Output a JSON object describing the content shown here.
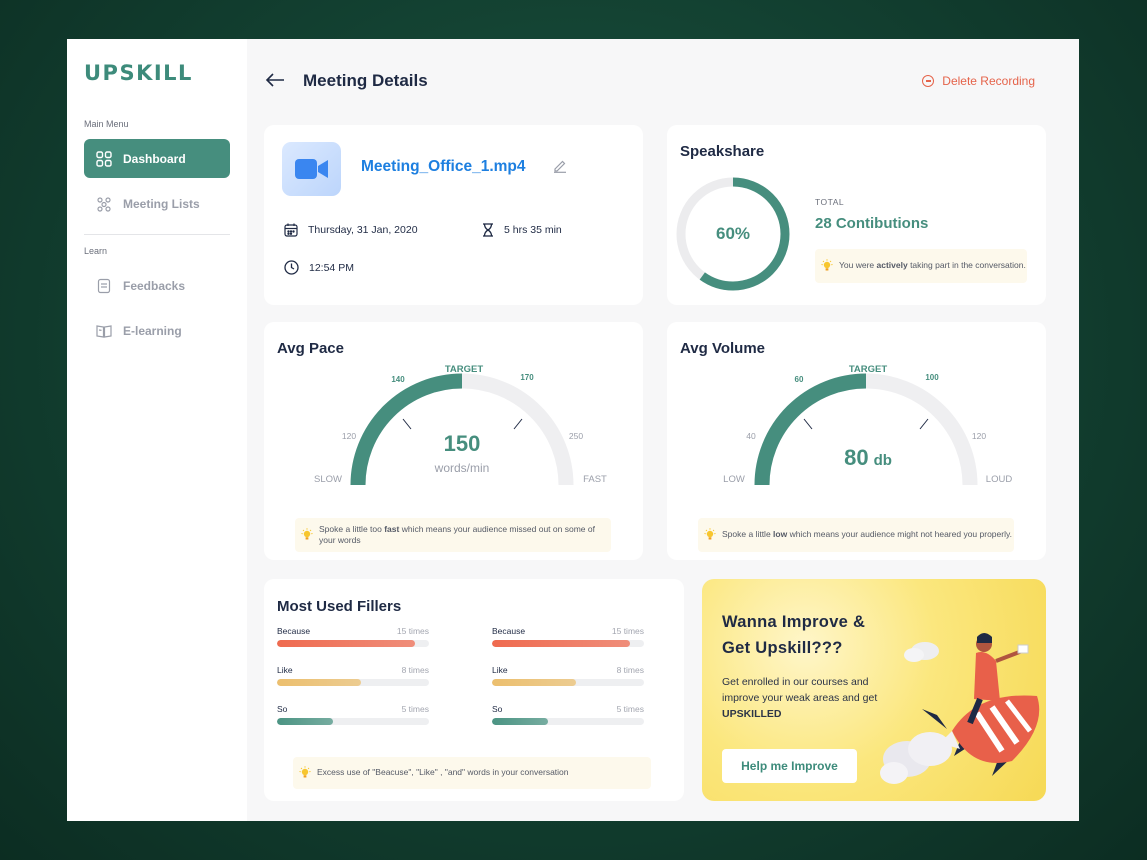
{
  "sidebar": {
    "logo": "UPSKILL",
    "main_menu_heading": "Main Menu",
    "items": [
      {
        "label": "Dashboard",
        "icon": "grid-icon",
        "active": true
      },
      {
        "label": "Meeting Lists",
        "icon": "people-icon",
        "active": false
      }
    ],
    "learn_heading": "Learn",
    "learn_items": [
      {
        "label": "Feedbacks",
        "icon": "document-icon"
      },
      {
        "label": "E-learning",
        "icon": "book-icon"
      }
    ]
  },
  "header": {
    "title": "Meeting Details",
    "delete_label": "Delete Recording"
  },
  "meeting": {
    "file_name": "Meeting_Office_1.mp4",
    "date": "Thursday, 31 Jan, 2020",
    "duration": "5 hrs 35 min",
    "time": "12:54 PM"
  },
  "speakshare": {
    "title": "Speakshare",
    "percent_label": "60%",
    "percent": 0.6,
    "total_label": "TOTAL",
    "contributions": "28 Contibutions",
    "tip_pre": "You were ",
    "tip_bold": "actively",
    "tip_post": " taking part in the conversation."
  },
  "pace": {
    "title": "Avg Pace",
    "value": "150",
    "unit": "words/min",
    "target_label": "TARGET",
    "min_label": "SLOW",
    "max_label": "FAST",
    "ticks": [
      "120",
      "140",
      "170",
      "250"
    ],
    "fill_fraction": 0.5,
    "tip_pre": "Spoke a little too ",
    "tip_bold": "fast",
    "tip_post": " which means your audience missed out on some of your words"
  },
  "volume": {
    "title": "Avg Volume",
    "value": "80",
    "unit": "db",
    "target_label": "TARGET",
    "min_label": "LOW",
    "max_label": "LOUD",
    "ticks": [
      "40",
      "60",
      "100",
      "120"
    ],
    "fill_fraction": 0.5,
    "tip_pre": "Spoke a little ",
    "tip_bold": "low",
    "tip_post": " which means your audience might not heared you properly."
  },
  "fillers": {
    "title": "Most Used Fillers",
    "columns": [
      [
        {
          "word": "Because",
          "count": "15 times",
          "fraction": 0.91,
          "color": "#ef6a4f"
        },
        {
          "word": "Like",
          "count": "8 times",
          "fraction": 0.55,
          "color": "#ecbf6e"
        },
        {
          "word": "So",
          "count": "5 times",
          "fraction": 0.37,
          "color": "#4b9483"
        }
      ],
      [
        {
          "word": "Because",
          "count": "15 times",
          "fraction": 0.91,
          "color": "#ef6a4f"
        },
        {
          "word": "Like",
          "count": "8 times",
          "fraction": 0.55,
          "color": "#ecbf6e"
        },
        {
          "word": "So",
          "count": "5 times",
          "fraction": 0.37,
          "color": "#4b9483"
        }
      ]
    ],
    "tip": "Excess use of \"Beacuse\", \"Like\" , \"and\" words in your conversation"
  },
  "promo": {
    "heading_line1": "Wanna Improve &",
    "heading_line2": "Get Upskill???",
    "body": "Get enrolled in our courses and improve your weak areas and get ",
    "body_bold": "UPSKILLED",
    "button": "Help me Improve"
  },
  "colors": {
    "accent": "#468e7e",
    "danger": "#e5634a",
    "link": "#1d7fe0"
  }
}
